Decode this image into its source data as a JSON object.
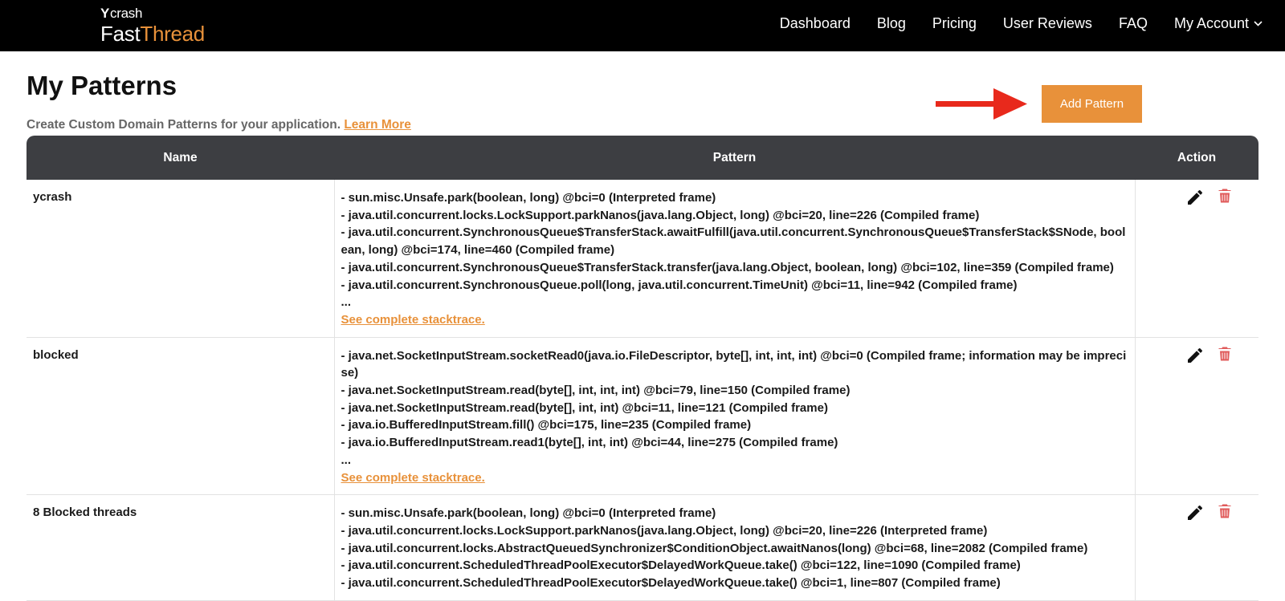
{
  "header": {
    "logo_small": "crash",
    "logo_fast": "Fast",
    "logo_thread": "Thread",
    "nav": [
      {
        "label": "Dashboard"
      },
      {
        "label": "Blog"
      },
      {
        "label": "Pricing"
      },
      {
        "label": "User Reviews"
      },
      {
        "label": "FAQ"
      },
      {
        "label": "My Account"
      }
    ]
  },
  "page": {
    "title": "My Patterns",
    "subtitle": "Create Custom Domain Patterns for your application.",
    "learn_more": "Learn More",
    "add_button": "Add Pattern"
  },
  "table": {
    "columns": [
      "Name",
      "Pattern",
      "Action"
    ],
    "see_complete": "See complete stacktrace.",
    "rows": [
      {
        "name": "ycrash",
        "lines": [
          "- sun.misc.Unsafe.park(boolean, long) @bci=0 (Interpreted frame)",
          "- java.util.concurrent.locks.LockSupport.parkNanos(java.lang.Object, long) @bci=20, line=226 (Compiled frame)",
          "- java.util.concurrent.SynchronousQueue$TransferStack.awaitFulfill(java.util.concurrent.SynchronousQueue$TransferStack$SNode, boolean, long) @bci=174, line=460 (Compiled frame)",
          "- java.util.concurrent.SynchronousQueue$TransferStack.transfer(java.lang.Object, boolean, long) @bci=102, line=359 (Compiled frame)",
          "- java.util.concurrent.SynchronousQueue.poll(long, java.util.concurrent.TimeUnit) @bci=11, line=942 (Compiled frame)",
          "..."
        ]
      },
      {
        "name": "blocked",
        "lines": [
          "- java.net.SocketInputStream.socketRead0(java.io.FileDescriptor, byte[], int, int, int) @bci=0 (Compiled frame; information may be imprecise)",
          "- java.net.SocketInputStream.read(byte[], int, int, int) @bci=79, line=150 (Compiled frame)",
          "- java.net.SocketInputStream.read(byte[], int, int) @bci=11, line=121 (Compiled frame)",
          "- java.io.BufferedInputStream.fill() @bci=175, line=235 (Compiled frame)",
          "- java.io.BufferedInputStream.read1(byte[], int, int) @bci=44, line=275 (Compiled frame)",
          "..."
        ]
      },
      {
        "name": "8 Blocked threads",
        "lines": [
          "- sun.misc.Unsafe.park(boolean, long) @bci=0 (Interpreted frame)",
          "- java.util.concurrent.locks.LockSupport.parkNanos(java.lang.Object, long) @bci=20, line=226 (Interpreted frame)",
          "- java.util.concurrent.locks.AbstractQueuedSynchronizer$ConditionObject.awaitNanos(long) @bci=68, line=2082 (Compiled frame)",
          "- java.util.concurrent.ScheduledThreadPoolExecutor$DelayedWorkQueue.take() @bci=122, line=1090 (Compiled frame)",
          "- java.util.concurrent.ScheduledThreadPoolExecutor$DelayedWorkQueue.take() @bci=1, line=807 (Compiled frame)"
        ]
      }
    ]
  },
  "colors": {
    "accent": "#e8913a",
    "header_bg": "#000000",
    "table_header_bg": "#3d3e42",
    "delete": "#e05a5a",
    "arrow": "#e8291c"
  },
  "icons": {
    "edit": "pencil-icon",
    "delete": "trash-icon",
    "dropdown": "chevron-down-icon",
    "pointer": "arrow-right-icon"
  }
}
